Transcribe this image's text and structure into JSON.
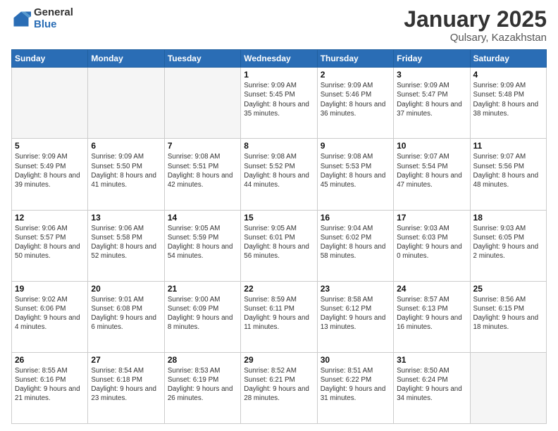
{
  "header": {
    "logo_general": "General",
    "logo_blue": "Blue",
    "month_title": "January 2025",
    "location": "Qulsary, Kazakhstan"
  },
  "weekdays": [
    "Sunday",
    "Monday",
    "Tuesday",
    "Wednesday",
    "Thursday",
    "Friday",
    "Saturday"
  ],
  "weeks": [
    [
      {
        "day": "",
        "empty": true
      },
      {
        "day": "",
        "empty": true
      },
      {
        "day": "",
        "empty": true
      },
      {
        "day": "1",
        "sunrise": "9:09 AM",
        "sunset": "5:45 PM",
        "daylight": "8 hours and 35 minutes."
      },
      {
        "day": "2",
        "sunrise": "9:09 AM",
        "sunset": "5:46 PM",
        "daylight": "8 hours and 36 minutes."
      },
      {
        "day": "3",
        "sunrise": "9:09 AM",
        "sunset": "5:47 PM",
        "daylight": "8 hours and 37 minutes."
      },
      {
        "day": "4",
        "sunrise": "9:09 AM",
        "sunset": "5:48 PM",
        "daylight": "8 hours and 38 minutes."
      }
    ],
    [
      {
        "day": "5",
        "sunrise": "9:09 AM",
        "sunset": "5:49 PM",
        "daylight": "8 hours and 39 minutes."
      },
      {
        "day": "6",
        "sunrise": "9:09 AM",
        "sunset": "5:50 PM",
        "daylight": "8 hours and 41 minutes."
      },
      {
        "day": "7",
        "sunrise": "9:08 AM",
        "sunset": "5:51 PM",
        "daylight": "8 hours and 42 minutes."
      },
      {
        "day": "8",
        "sunrise": "9:08 AM",
        "sunset": "5:52 PM",
        "daylight": "8 hours and 44 minutes."
      },
      {
        "day": "9",
        "sunrise": "9:08 AM",
        "sunset": "5:53 PM",
        "daylight": "8 hours and 45 minutes."
      },
      {
        "day": "10",
        "sunrise": "9:07 AM",
        "sunset": "5:54 PM",
        "daylight": "8 hours and 47 minutes."
      },
      {
        "day": "11",
        "sunrise": "9:07 AM",
        "sunset": "5:56 PM",
        "daylight": "8 hours and 48 minutes."
      }
    ],
    [
      {
        "day": "12",
        "sunrise": "9:06 AM",
        "sunset": "5:57 PM",
        "daylight": "8 hours and 50 minutes."
      },
      {
        "day": "13",
        "sunrise": "9:06 AM",
        "sunset": "5:58 PM",
        "daylight": "8 hours and 52 minutes."
      },
      {
        "day": "14",
        "sunrise": "9:05 AM",
        "sunset": "5:59 PM",
        "daylight": "8 hours and 54 minutes."
      },
      {
        "day": "15",
        "sunrise": "9:05 AM",
        "sunset": "6:01 PM",
        "daylight": "8 hours and 56 minutes."
      },
      {
        "day": "16",
        "sunrise": "9:04 AM",
        "sunset": "6:02 PM",
        "daylight": "8 hours and 58 minutes."
      },
      {
        "day": "17",
        "sunrise": "9:03 AM",
        "sunset": "6:03 PM",
        "daylight": "9 hours and 0 minutes."
      },
      {
        "day": "18",
        "sunrise": "9:03 AM",
        "sunset": "6:05 PM",
        "daylight": "9 hours and 2 minutes."
      }
    ],
    [
      {
        "day": "19",
        "sunrise": "9:02 AM",
        "sunset": "6:06 PM",
        "daylight": "9 hours and 4 minutes."
      },
      {
        "day": "20",
        "sunrise": "9:01 AM",
        "sunset": "6:08 PM",
        "daylight": "9 hours and 6 minutes."
      },
      {
        "day": "21",
        "sunrise": "9:00 AM",
        "sunset": "6:09 PM",
        "daylight": "9 hours and 8 minutes."
      },
      {
        "day": "22",
        "sunrise": "8:59 AM",
        "sunset": "6:11 PM",
        "daylight": "9 hours and 11 minutes."
      },
      {
        "day": "23",
        "sunrise": "8:58 AM",
        "sunset": "6:12 PM",
        "daylight": "9 hours and 13 minutes."
      },
      {
        "day": "24",
        "sunrise": "8:57 AM",
        "sunset": "6:13 PM",
        "daylight": "9 hours and 16 minutes."
      },
      {
        "day": "25",
        "sunrise": "8:56 AM",
        "sunset": "6:15 PM",
        "daylight": "9 hours and 18 minutes."
      }
    ],
    [
      {
        "day": "26",
        "sunrise": "8:55 AM",
        "sunset": "6:16 PM",
        "daylight": "9 hours and 21 minutes."
      },
      {
        "day": "27",
        "sunrise": "8:54 AM",
        "sunset": "6:18 PM",
        "daylight": "9 hours and 23 minutes."
      },
      {
        "day": "28",
        "sunrise": "8:53 AM",
        "sunset": "6:19 PM",
        "daylight": "9 hours and 26 minutes."
      },
      {
        "day": "29",
        "sunrise": "8:52 AM",
        "sunset": "6:21 PM",
        "daylight": "9 hours and 28 minutes."
      },
      {
        "day": "30",
        "sunrise": "8:51 AM",
        "sunset": "6:22 PM",
        "daylight": "9 hours and 31 minutes."
      },
      {
        "day": "31",
        "sunrise": "8:50 AM",
        "sunset": "6:24 PM",
        "daylight": "9 hours and 34 minutes."
      },
      {
        "day": "",
        "empty": true
      }
    ]
  ]
}
